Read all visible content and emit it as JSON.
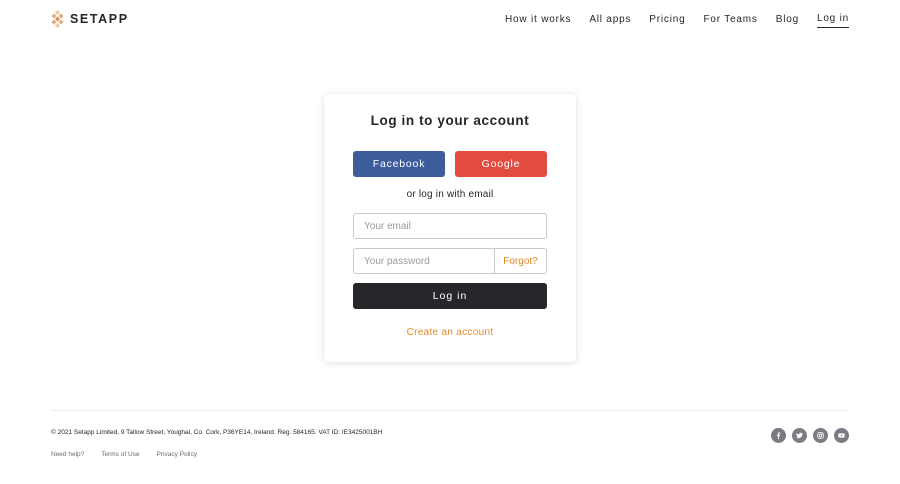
{
  "header": {
    "brand": "SETAPP",
    "nav": [
      {
        "label": "How it works"
      },
      {
        "label": "All apps"
      },
      {
        "label": "Pricing"
      },
      {
        "label": "For Teams"
      },
      {
        "label": "Blog"
      },
      {
        "label": "Log in",
        "active": true
      }
    ]
  },
  "login": {
    "title": "Log in to your account",
    "facebook_label": "Facebook",
    "google_label": "Google",
    "or_text": "or log in with email",
    "email_placeholder": "Your email",
    "password_placeholder": "Your password",
    "forgot_label": "Forgot?",
    "submit_label": "Log in",
    "create_account_label": "Create an account"
  },
  "footer": {
    "copyright": "© 2021 Setapp Limited, 9 Tallow Street, Youghal, Co. Cork, P36YE14, Ireland. Reg. 584165. VAT ID: IE3425001BH",
    "links": [
      {
        "label": "Need help?"
      },
      {
        "label": "Terms of Use"
      },
      {
        "label": "Privacy Policy"
      }
    ],
    "socials": [
      {
        "icon": "facebook-icon"
      },
      {
        "icon": "twitter-icon"
      },
      {
        "icon": "instagram-icon"
      },
      {
        "icon": "youtube-icon"
      }
    ]
  },
  "colors": {
    "text": "#26262b",
    "facebook": "#3c5c9c",
    "google": "#e24c3f",
    "accent": "#e28a2c",
    "dark_button": "#26262b",
    "social_icon_bg": "#7b7b84"
  }
}
